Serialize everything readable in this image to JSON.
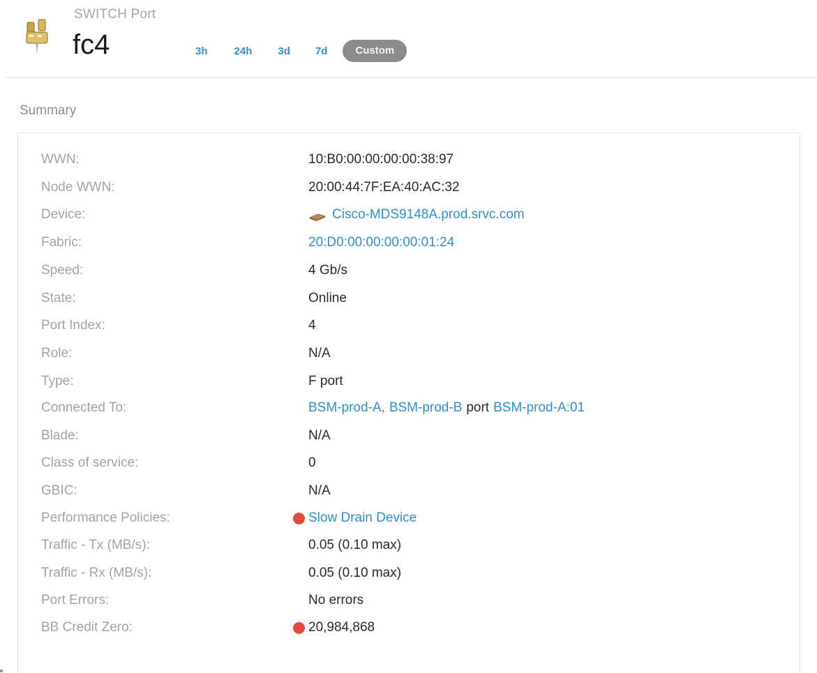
{
  "header": {
    "object_type": "SWITCH Port",
    "title": "fc4",
    "icon": "switch-port-icon",
    "time_ranges": [
      "3h",
      "24h",
      "3d",
      "7d"
    ],
    "custom_label": "Custom"
  },
  "summary": {
    "heading": "Summary",
    "rows": {
      "wwn": {
        "label": "WWN:",
        "value": "10:B0:00:00:00:00:38:97"
      },
      "node_wwn": {
        "label": "Node WWN:",
        "value": "20:00:44:7F:EA:40:AC:32"
      },
      "device": {
        "label": "Device:",
        "value": "Cisco-MDS9148A.prod.srvc.com",
        "icon": "switch-device-icon"
      },
      "fabric": {
        "label": "Fabric:",
        "value": "20:D0:00:00:00:00:01:24"
      },
      "speed": {
        "label": "Speed:",
        "value": "4 Gb/s"
      },
      "state": {
        "label": "State:",
        "value": "Online"
      },
      "port_index": {
        "label": "Port Index:",
        "value": "4"
      },
      "role": {
        "label": "Role:",
        "value": "N/A"
      },
      "type": {
        "label": "Type:",
        "value": "F port"
      },
      "connected_to": {
        "label": "Connected To:",
        "link1": "BSM-prod-A,",
        "link2": "BSM-prod-B",
        "middle": "port",
        "link3": "BSM-prod-A:01"
      },
      "blade": {
        "label": "Blade:",
        "value": "N/A"
      },
      "class_of_service": {
        "label": "Class of service:",
        "value": "0"
      },
      "gbic": {
        "label": "GBIC:",
        "value": "N/A"
      },
      "performance_policies": {
        "label": "Performance Policies:",
        "value": "Slow Drain Device",
        "indicator_color": "#e24b3b"
      },
      "traffic_tx": {
        "label": "Traffic - Tx (MB/s):",
        "value": "0.05 (0.10 max)"
      },
      "traffic_rx": {
        "label": "Traffic - Rx (MB/s):",
        "value": "0.05 (0.10 max)"
      },
      "port_errors": {
        "label": "Port Errors:",
        "value": "No errors"
      },
      "bb_credit_zero": {
        "label": "BB Credit Zero:",
        "value": "20,984,868",
        "indicator_color": "#e24b3b"
      }
    }
  },
  "colors": {
    "link": "#2f8fcf",
    "label": "#a3a3a3",
    "alert": "#e24b3b",
    "pill": "#8c8c8c"
  }
}
